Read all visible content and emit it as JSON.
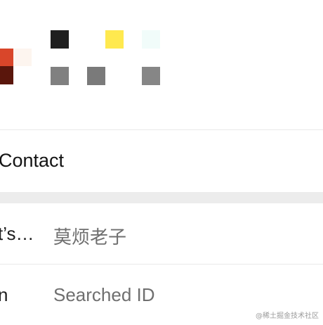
{
  "swatches": [
    {
      "color": "#d9462a"
    },
    {
      "color": "#5a160c"
    },
    {
      "color": "#fdf5ef"
    },
    {
      "color": "#1f1f1f"
    },
    {
      "color": "#808080"
    },
    {
      "color": "#7a7a7a"
    },
    {
      "color": "#ffe94f"
    },
    {
      "color": "#f1fcfa"
    },
    {
      "color": "#868686"
    }
  ],
  "contact": {
    "label": "Contact"
  },
  "rows": [
    {
      "key": "t’s…",
      "value": "莫烦老子"
    },
    {
      "key": "n",
      "value": "Searched ID"
    }
  ],
  "watermark": "@稀土掘金技术社区"
}
